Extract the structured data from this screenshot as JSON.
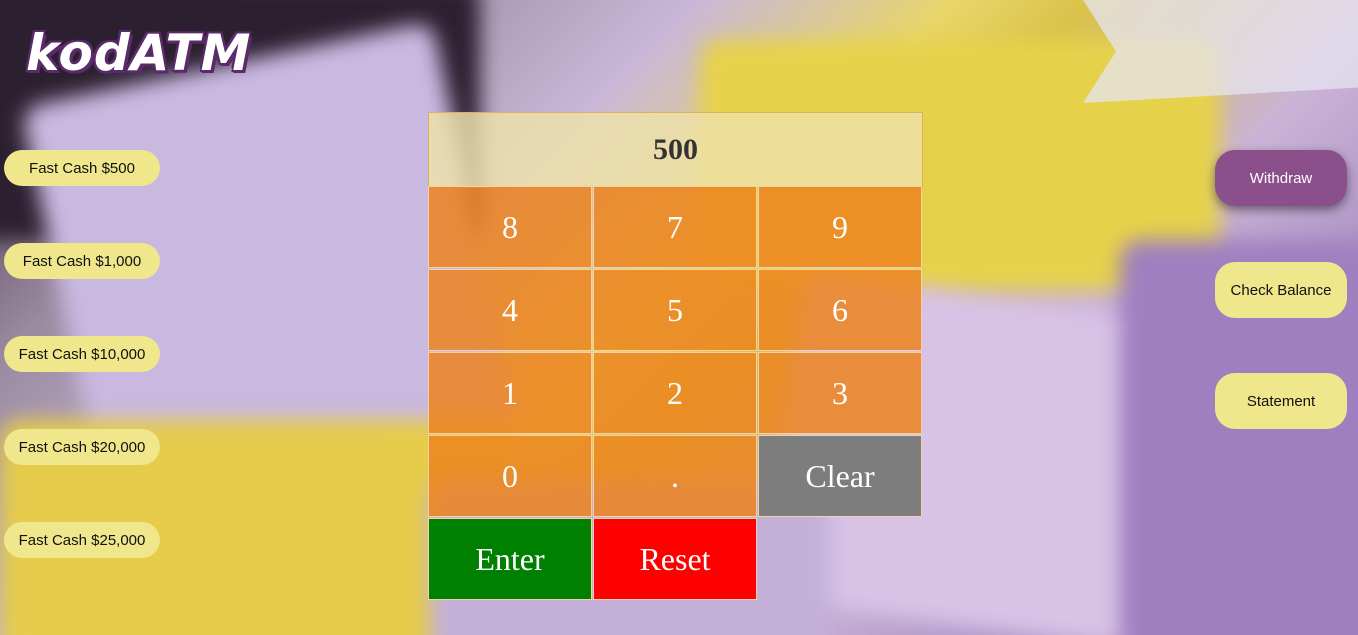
{
  "app": {
    "logo": "kodATM"
  },
  "display": {
    "value": "500"
  },
  "fast_cash": [
    {
      "label": "Fast Cash $500"
    },
    {
      "label": "Fast Cash $1,000"
    },
    {
      "label": "Fast Cash $10,000"
    },
    {
      "label": "Fast Cash $20,000"
    },
    {
      "label": "Fast Cash $25,000"
    }
  ],
  "actions": {
    "withdraw": "Withdraw",
    "check_balance": "Check Balance",
    "statement": "Statement"
  },
  "keypad": {
    "keys": [
      "8",
      "7",
      "9",
      "4",
      "5",
      "6",
      "1",
      "2",
      "3",
      "0",
      ".",
      "Clear"
    ],
    "enter": "Enter",
    "reset": "Reset"
  },
  "colors": {
    "button_yellow": "#f0e68c",
    "withdraw_purple": "#8b4f8c",
    "key_orange": "#ec841e",
    "clear_gray": "#7d7d7d",
    "enter_green": "#008000",
    "reset_red": "#ff0000"
  }
}
